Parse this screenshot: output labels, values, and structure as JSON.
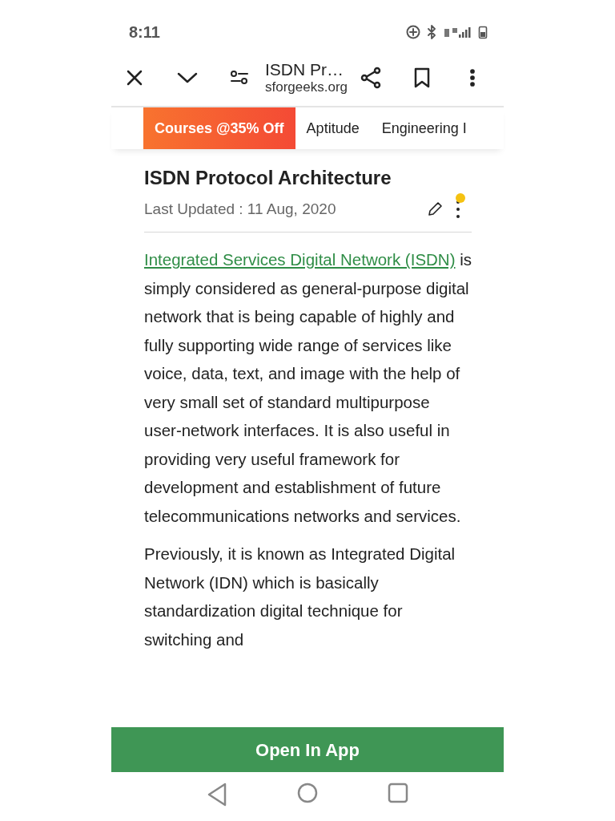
{
  "status_bar": {
    "time": "8:11"
  },
  "toolbar": {
    "title": "ISDN Pr…",
    "url": "sforgeeks.org"
  },
  "nav_tabs": [
    {
      "label": "Courses @35% Off",
      "kind": "promo"
    },
    {
      "label": "Aptitude",
      "kind": "plain"
    },
    {
      "label": "Engineering I",
      "kind": "plain"
    }
  ],
  "article": {
    "title": "ISDN Protocol Architecture",
    "updated": "Last Updated : 11 Aug, 2020",
    "notification_dot": true,
    "paragraphs": [
      {
        "link": "Integrated Services Digital Network (ISDN)",
        "text": " is simply considered as general-purpose digital network that is being capable of highly and fully supporting wide range of services like voice, data, text, and image with the help of very small set of standard multipurpose user-network interfaces. It is also useful in providing very useful framework for development and establishment of future telecommunications networks and services."
      },
      {
        "text": "Previously, it is known as Integrated Digital Network (IDN) which is basically standardization digital technique for switching and"
      }
    ]
  },
  "open_app_button": "Open In App"
}
